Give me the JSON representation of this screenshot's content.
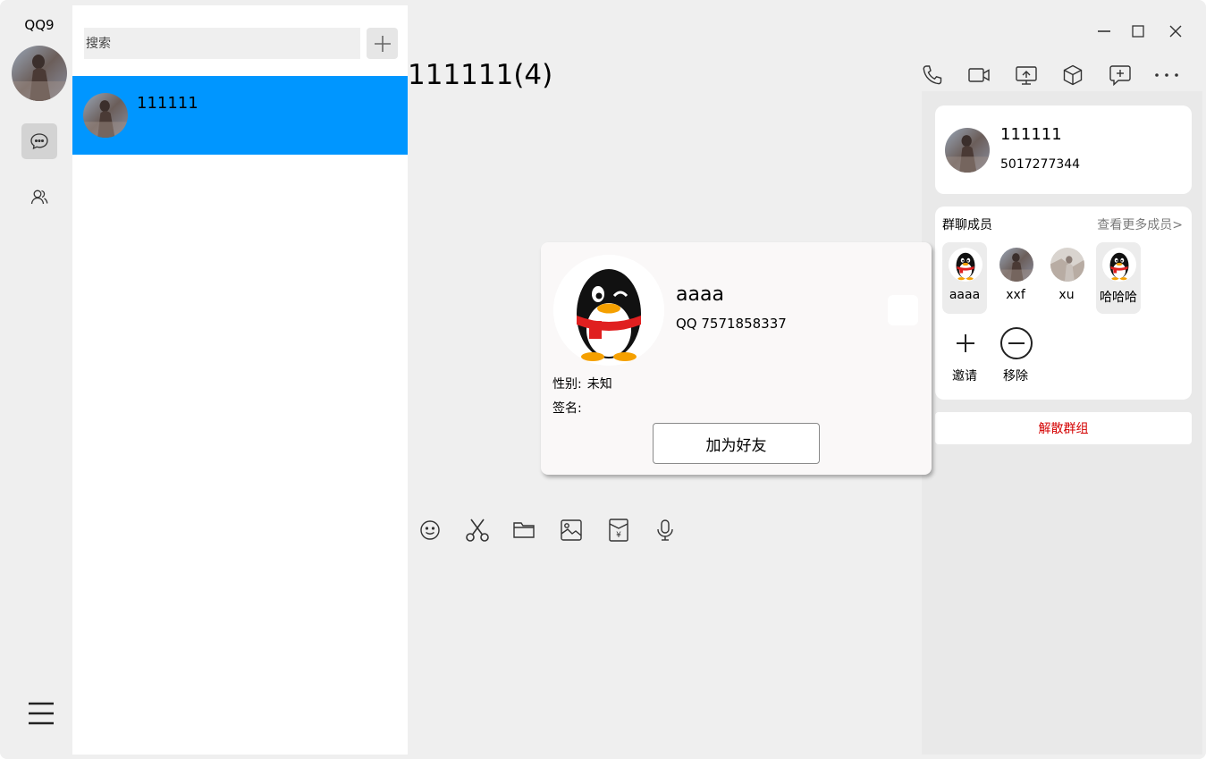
{
  "app": {
    "name": "QQ9"
  },
  "search": {
    "placeholder": "搜索"
  },
  "conversations": [
    {
      "name": "111111"
    }
  ],
  "chat": {
    "title": "111111(4)"
  },
  "group_info": {
    "name": "111111",
    "number": "5017277344",
    "members_title": "群聊成员",
    "more_members": "查看更多成员>",
    "members": [
      {
        "name": "aaaa",
        "avatar": "penguin-icon"
      },
      {
        "name": "xxf",
        "avatar": "photo"
      },
      {
        "name": "xu",
        "avatar": "photo"
      },
      {
        "name": "哈哈哈",
        "avatar": "penguin-icon"
      }
    ],
    "invite_label": "邀请",
    "remove_label": "移除",
    "dissolve_label": "解散群组"
  },
  "profile_popup": {
    "name": "aaaa",
    "qq": "QQ 7571858337",
    "gender_label": "性别:",
    "gender_value": "未知",
    "signature_label": "签名:",
    "signature_value": "",
    "add_friend_label": "加为好友"
  },
  "colors": {
    "selected_item": "#0096ff",
    "dissolve_text": "#d40000",
    "window_bg": "#efefef"
  }
}
